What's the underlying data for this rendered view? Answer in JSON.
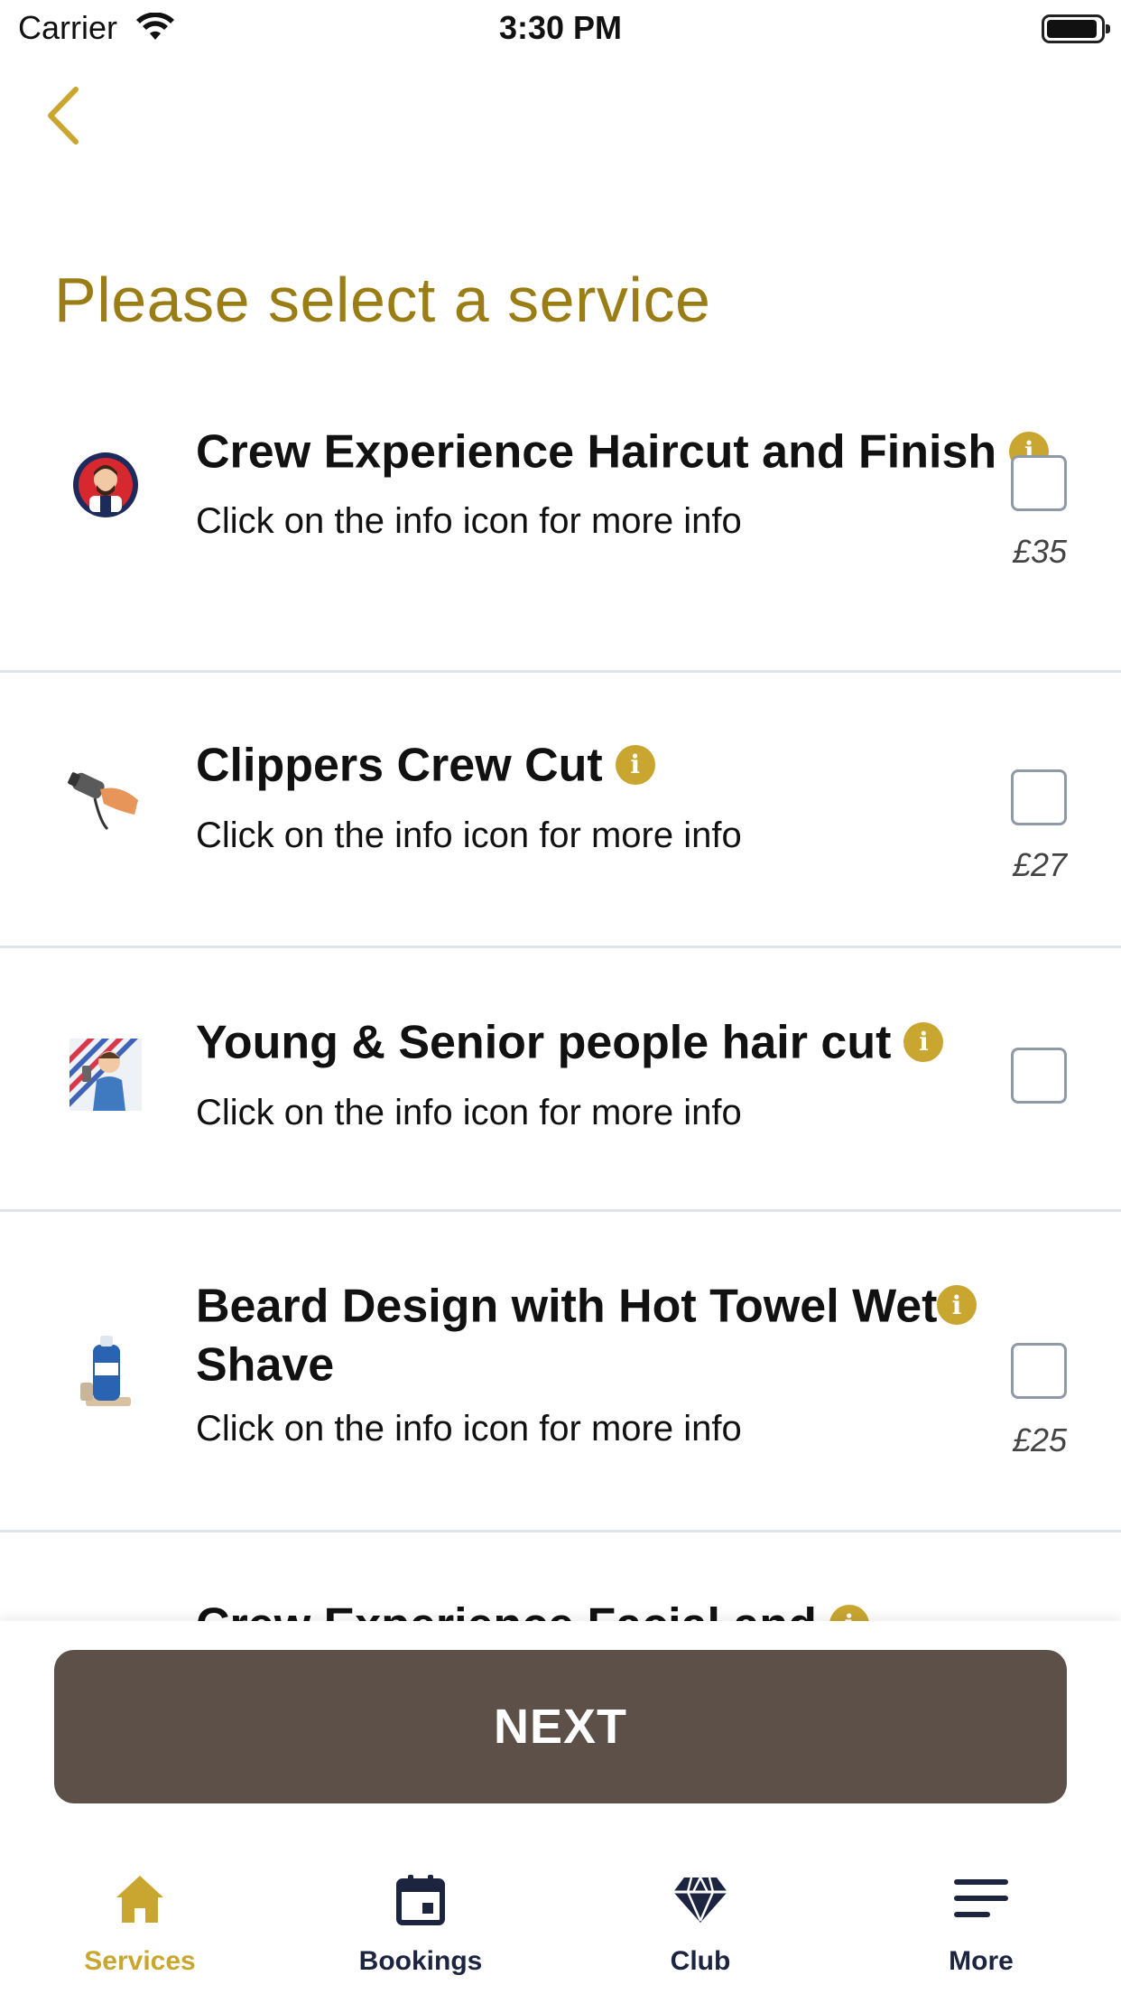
{
  "status_bar": {
    "carrier": "Carrier",
    "time": "3:30 PM"
  },
  "page": {
    "title": "Please select a service"
  },
  "services": [
    {
      "name": "Crew Experience Haircut and Finish",
      "subtitle": "Click on the info icon for more info",
      "price": "£35",
      "checked": false,
      "icon": "barber-avatar-icon"
    },
    {
      "name": "Clippers Crew Cut",
      "subtitle": "Click on the info icon for more info",
      "price": "£27",
      "checked": false,
      "icon": "hair-clipper-icon"
    },
    {
      "name": "Young & Senior people hair cut",
      "subtitle": "Click on the info icon for more info",
      "price": "",
      "checked": false,
      "icon": "barber-man-icon"
    },
    {
      "name": "Beard Design with Hot Towel Wet Shave",
      "subtitle": "Click on the info icon for more info",
      "price": "£25",
      "checked": false,
      "icon": "shave-cream-icon"
    },
    {
      "name": "Crew Experience Facial and",
      "subtitle": "",
      "price": "",
      "checked": false,
      "icon": ""
    }
  ],
  "actions": {
    "next_label": "NEXT"
  },
  "tab_bar": {
    "items": [
      {
        "label": "Services",
        "icon": "home-icon",
        "active": true
      },
      {
        "label": "Bookings",
        "icon": "calendar-icon",
        "active": false
      },
      {
        "label": "Club",
        "icon": "diamond-icon",
        "active": false
      },
      {
        "label": "More",
        "icon": "menu-icon",
        "active": false
      }
    ]
  },
  "colors": {
    "accent": "#c9a630",
    "title": "#9a7d14",
    "button": "#5c5048",
    "tab_text": "#1c2440"
  }
}
